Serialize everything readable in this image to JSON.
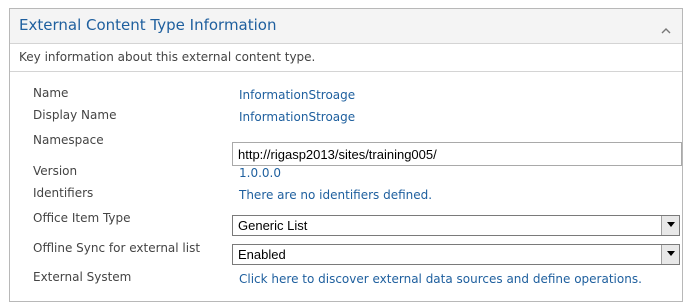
{
  "panel": {
    "title": "External Content Type Information",
    "description": "Key information about this external content type.",
    "collapse_icon": "chevron-up-icon"
  },
  "fields": {
    "name": {
      "label": "Name",
      "value": "InformationStroage"
    },
    "display_name": {
      "label": "Display Name",
      "value": "InformationStroage"
    },
    "namespace": {
      "label": "Namespace",
      "value": "http://rigasp2013/sites/training005/"
    },
    "version": {
      "label": "Version",
      "value": "1.0.0.0"
    },
    "identifiers": {
      "label": "Identifiers",
      "value": "There are no identifiers defined."
    },
    "office_item_type": {
      "label": "Office Item Type",
      "selected": "Generic List"
    },
    "offline_sync": {
      "label": "Offline Sync for external list",
      "selected": "Enabled"
    },
    "external_system": {
      "label": "External System",
      "link": "Click here to discover external data sources and define operations."
    }
  },
  "colors": {
    "link": "#1e5f9e",
    "label": "#444444",
    "header_bg": "#f4f4f4"
  }
}
